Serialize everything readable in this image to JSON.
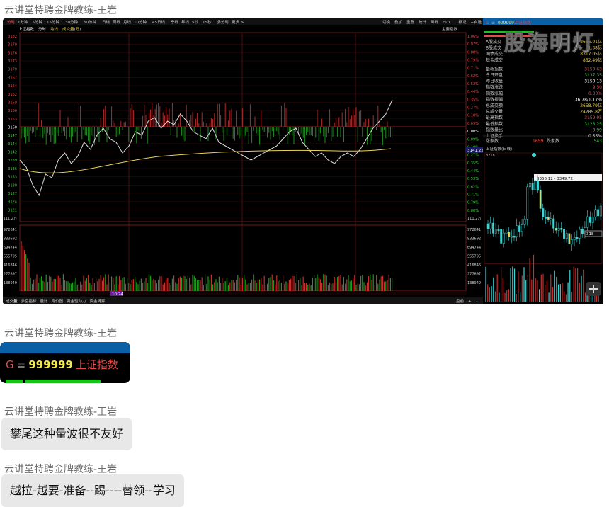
{
  "messages": [
    {
      "sender": "云讲堂特聘金牌教练-王岩"
    },
    {
      "sender": "云讲堂特聘金牌教练-王岩",
      "card": {
        "g": "G",
        "menu": "≡",
        "code": "999999",
        "name": "上证指数"
      }
    },
    {
      "sender": "云讲堂特聘金牌教练-王岩",
      "text": "攀尾这种量波很不友好"
    },
    {
      "sender": "云讲堂特聘金牌教练-王岩",
      "text": "越拉-越要-准备--踢----替领--学习"
    }
  ],
  "watermark": "股海明灯",
  "terminal": {
    "period_tabs": [
      "分时",
      "1分钟",
      "5分钟",
      "15分钟",
      "30分钟",
      "60分钟",
      "日线",
      "周线",
      "月线",
      "10分钟",
      "45日线",
      "季线",
      "年线",
      "5秒",
      "15秒",
      "多分时",
      "更多 >"
    ],
    "right_menu": [
      "切换",
      "叠加",
      "重叠",
      "统计",
      "画线",
      "F10",
      "标记",
      "+自选",
      "返回"
    ],
    "chart_header": [
      "上证指数",
      "分时",
      "均线",
      "成交量(万)"
    ],
    "main_index_label": "主要指数",
    "left_axis": [
      "3182",
      "3179",
      "3176",
      "3173",
      "3170",
      "3167",
      "3164",
      "3162",
      "3159",
      "3156",
      "3153",
      "3150",
      "3147",
      "3144",
      "3142",
      "3139",
      "3136",
      "3133",
      "3130",
      "3127",
      "3124",
      "3121",
      "111.2万"
    ],
    "right_axis": [
      "1.06%",
      "0.97%",
      "0.88%",
      "0.79%",
      "0.71%",
      "0.62%",
      "0.53%",
      "0.44%",
      "0.35%",
      "0.27%",
      "0.18%",
      "0.09%",
      "0.00%",
      "0.09%",
      "0.18%",
      "0.27%",
      "0.35%",
      "0.44%",
      "0.53%",
      "0.62%",
      "0.71%",
      "0.79%",
      "0.88%",
      "111.2万"
    ],
    "vol_left_axis": [
      "972641",
      "833692",
      "694744",
      "555795",
      "416846",
      "277897",
      "138949"
    ],
    "current_price": "3141.22",
    "cursor_time": "10:24",
    "bottom_tabs": [
      "成交量",
      "多空指标",
      "量比",
      "竞价图",
      "资金驱动力",
      "资金博弈"
    ],
    "bottom_right": [
      "盘前",
      "+",
      "-"
    ],
    "quote": {
      "header_code": "999999",
      "header_name": "上证指数",
      "rows": [
        {
          "label": "A股成交",
          "value": "2656.01亿",
          "color": "#f0d34a"
        },
        {
          "label": "B股成交",
          "value": "1.38亿",
          "color": "#f0d34a"
        },
        {
          "label": "国债成交",
          "value": "8317.05亿",
          "color": "#f0d34a"
        },
        {
          "label": "基金成交",
          "value": "852.49亿",
          "color": "#f0d34a"
        },
        {
          "label": "最新指数",
          "value": "3159.63",
          "color": "#e84a4a"
        },
        {
          "label": "今日开盘",
          "value": "3137.35",
          "color": "#3bd63b"
        },
        {
          "label": "昨日收盘",
          "value": "3150.13",
          "color": "#ffffff"
        },
        {
          "label": "指数涨跌",
          "value": "9.50",
          "color": "#e84a4a"
        },
        {
          "label": "指数涨幅",
          "value": "0.30%",
          "color": "#e84a4a"
        },
        {
          "label": "指数振幅",
          "value": "36.78/1.17%",
          "color": "#ffffff"
        },
        {
          "label": "总成交额",
          "value": "2658.79亿",
          "color": "#f0d34a"
        },
        {
          "label": "总成交量",
          "value": "24289.8万",
          "color": "#f0d34a"
        },
        {
          "label": "最高指数",
          "value": "3159.95",
          "color": "#e84a4a"
        },
        {
          "label": "最低指数",
          "value": "3123.25",
          "color": "#3bd63b"
        },
        {
          "label": "指数量比",
          "value": "0.99",
          "color": "#3bd63b"
        },
        {
          "label": "上证换手",
          "value": "0.55%",
          "color": "#ffffff"
        }
      ],
      "up_label": "涨家数",
      "up_count": "1659",
      "down_label": "跌家数",
      "down_count": "543",
      "mini_title": "上证指数(日线)",
      "mini_range": "3356.12 - 3349.72",
      "mini_top": "3218",
      "mini_marker": "318"
    }
  },
  "colors": {
    "up": "#e84a4a",
    "down": "#3bd63b",
    "price_line": "#dddddd",
    "avg_line": "#e5d55a",
    "card_header": "#0b5fa5"
  }
}
